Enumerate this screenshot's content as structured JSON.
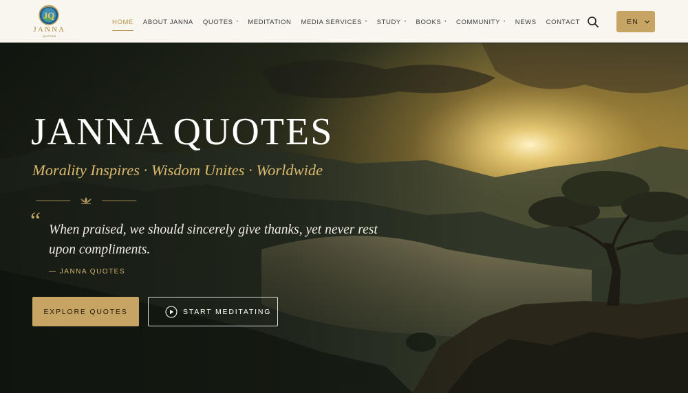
{
  "brand": {
    "logo_wordmark": "JANNA",
    "logo_subword": "QUOTES",
    "logo_tagline": "MORALITY INSPIRES · WISDOM UNITES"
  },
  "nav": {
    "items": [
      {
        "label": "HOME",
        "active": true,
        "has_dropdown": false
      },
      {
        "label": "ABOUT JANNA",
        "active": false,
        "has_dropdown": false
      },
      {
        "label": "QUOTES",
        "active": false,
        "has_dropdown": true
      },
      {
        "label": "MEDITATION",
        "active": false,
        "has_dropdown": false
      },
      {
        "label": "MEDIA SERVICES",
        "active": false,
        "has_dropdown": true
      },
      {
        "label": "STUDY",
        "active": false,
        "has_dropdown": true
      },
      {
        "label": "BOOKS",
        "active": false,
        "has_dropdown": true
      },
      {
        "label": "COMMUNITY",
        "active": false,
        "has_dropdown": true
      },
      {
        "label": "NEWS",
        "active": false,
        "has_dropdown": false
      },
      {
        "label": "CONTACT",
        "active": false,
        "has_dropdown": false
      }
    ],
    "search_icon": "search-icon",
    "language": {
      "selected": "EN",
      "icon": "chevron-down-icon"
    }
  },
  "hero": {
    "title": "JANNA QUOTES",
    "tagline": "Morality Inspires · Wisdom Unites · Worldwide",
    "quote_mark": "“",
    "quote": "When praised, we should sincerely give thanks, yet never rest upon compliments.",
    "quote_author": "— JANNA QUOTES",
    "primary_button": "EXPLORE QUOTES",
    "secondary_button": "START MEDITATING",
    "secondary_button_icon": "play-circle-icon"
  },
  "colors": {
    "accent_gold": "#c6a463",
    "tagline_gold": "#d9b96e",
    "header_bg": "#f8f6ef",
    "active_nav": "#b8924a"
  }
}
